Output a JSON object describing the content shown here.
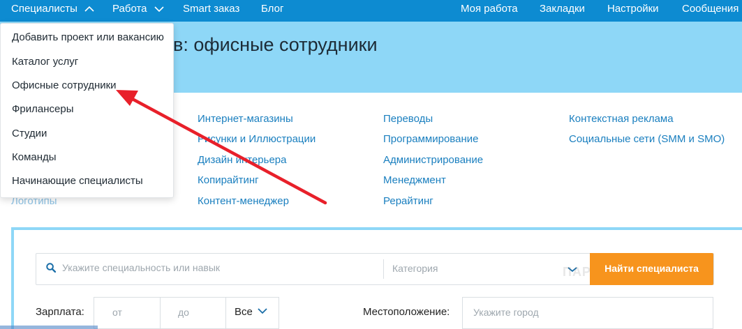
{
  "nav": {
    "left": [
      {
        "label": "Специалисты",
        "icon": "chevron-up-icon"
      },
      {
        "label": "Работа",
        "icon": "chevron-down-icon"
      },
      {
        "label": "Smart заказ"
      },
      {
        "label": "Блог"
      }
    ],
    "right": [
      "Моя работа",
      "Закладки",
      "Настройки",
      "Сообщения"
    ]
  },
  "hero": {
    "title": "в: офисные сотрудники"
  },
  "dropdown": {
    "items": [
      "Добавить проект или вакансию",
      "Каталог услуг",
      "Офисные сотрудники",
      "Фрилансеры",
      "Студии",
      "Команды",
      "Начинающие специалисты"
    ]
  },
  "categories": {
    "col0": [
      "Логотипы"
    ],
    "col1": [
      "Интернет-магазины",
      "Рисунки и Иллюстрации",
      "Дизайн интерьера",
      "Копирайтинг",
      "Контент-менеджер"
    ],
    "col2": [
      "Переводы",
      "Программирование",
      "Администрирование",
      "Менеджмент",
      "Рерайтинг"
    ],
    "col3": [
      "Контекстная реклама",
      "Социальные сети (SMM и SMO)"
    ]
  },
  "search": {
    "query_placeholder": "Укажите специальность или навык",
    "category_placeholder": "Категория",
    "button_label": "Найти специалиста",
    "watermark": "ПАРТНЕРКИН"
  },
  "filters": {
    "salary_label": "Зарплата:",
    "from_placeholder": "от",
    "to_placeholder": "до",
    "currency_value": "Все",
    "location_label": "Местоположение:",
    "location_placeholder": "Укажите город"
  },
  "colors": {
    "nav_bg": "#0d8bd1",
    "hero_bg": "#8ed7f7",
    "link": "#1a7fbf",
    "button": "#f7941d",
    "arrow": "#e8202a"
  }
}
